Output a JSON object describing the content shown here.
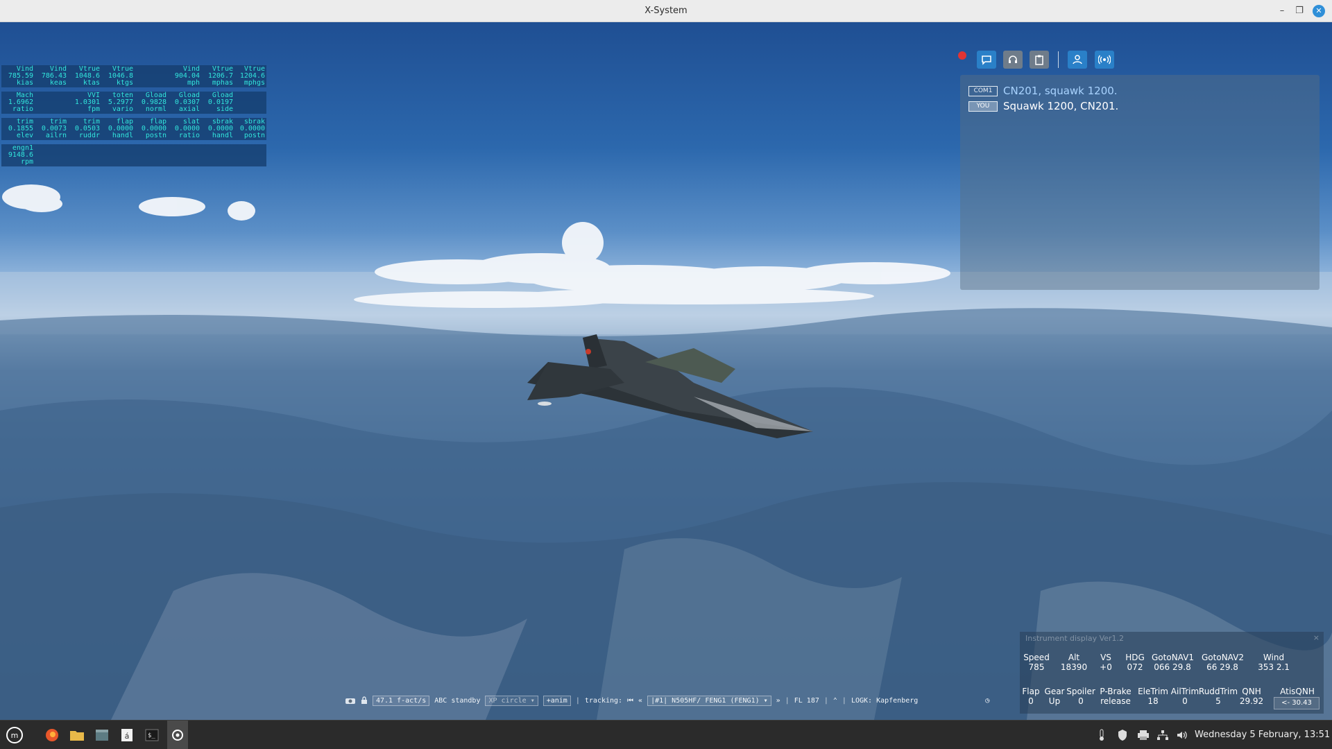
{
  "window": {
    "title": "X-System"
  },
  "data_output": {
    "rows": [
      [
        {
          "name": "Vind",
          "value": "785.59",
          "unit": "kias"
        },
        {
          "name": "Vind",
          "value": "786.43",
          "unit": "keas"
        },
        {
          "name": "Vtrue",
          "value": "1048.6",
          "unit": "ktas"
        },
        {
          "name": "Vtrue",
          "value": "1046.8",
          "unit": "ktgs"
        },
        {
          "name": "",
          "value": "",
          "unit": ""
        },
        {
          "name": "Vind",
          "value": "904.04",
          "unit": "mph"
        },
        {
          "name": "Vtrue",
          "value": "1206.7",
          "unit": "mphas"
        },
        {
          "name": "Vtrue",
          "value": "1204.6",
          "unit": "mphgs"
        }
      ],
      [
        {
          "name": "Mach",
          "value": "1.6962",
          "unit": "ratio"
        },
        {
          "name": "",
          "value": "",
          "unit": ""
        },
        {
          "name": "VVI",
          "value": "1.0301",
          "unit": "fpm"
        },
        {
          "name": "toten",
          "value": "5.2977",
          "unit": "vario"
        },
        {
          "name": "Gload",
          "value": "0.9828",
          "unit": "norml"
        },
        {
          "name": "Gload",
          "value": "0.0307",
          "unit": "axial"
        },
        {
          "name": "Gload",
          "value": "0.0197",
          "unit": "side"
        },
        {
          "name": "",
          "value": "",
          "unit": ""
        }
      ],
      [
        {
          "name": "trim",
          "value": "0.1855",
          "unit": "elev"
        },
        {
          "name": "trim",
          "value": "0.0073",
          "unit": "ailrn"
        },
        {
          "name": "trim",
          "value": "0.0503",
          "unit": "ruddr"
        },
        {
          "name": "flap",
          "value": "0.0000",
          "unit": "handl"
        },
        {
          "name": "flap",
          "value": "0.0000",
          "unit": "postn"
        },
        {
          "name": "slat",
          "value": "0.0000",
          "unit": "ratio"
        },
        {
          "name": "sbrak",
          "value": "0.0000",
          "unit": "handl"
        },
        {
          "name": "sbrak",
          "value": "0.0000",
          "unit": "postn"
        }
      ],
      [
        {
          "name": "engn1",
          "value": "9148.6",
          "unit": "rpm"
        }
      ]
    ]
  },
  "atc": {
    "messages": [
      {
        "tag": "COM1",
        "text": "CN201, squawk 1200."
      },
      {
        "tag": "YOU",
        "text": "Squawk 1200, CN201."
      }
    ]
  },
  "instrument_display": {
    "title": "Instrument display Ver1.2",
    "row1": [
      {
        "label": "Speed",
        "value": "785"
      },
      {
        "label": "Alt",
        "value": "18390"
      },
      {
        "label": "VS",
        "value": "+0"
      },
      {
        "label": "HDG",
        "value": "072"
      },
      {
        "label": "GotoNAV1",
        "value": "066   29.8"
      },
      {
        "label": "GotoNAV2",
        "value": "66   29.8"
      },
      {
        "label": "Wind",
        "value": "353   2.1"
      }
    ],
    "row2": [
      {
        "label": "Flap",
        "value": "0"
      },
      {
        "label": "Gear",
        "value": "Up"
      },
      {
        "label": "Spoiler",
        "value": "0"
      },
      {
        "label": "P-Brake",
        "value": "release"
      },
      {
        "label": "EleTrim",
        "value": "18"
      },
      {
        "label": "AilTrim",
        "value": "0"
      },
      {
        "label": "RuddTrim",
        "value": "5"
      },
      {
        "label": "QNH",
        "value": "29.92"
      },
      {
        "label": "AtisQNH",
        "value": "<- 30.43"
      }
    ]
  },
  "control_bar": {
    "speed": "47.1 f-act/s",
    "abc": "ABC standby",
    "xp": "XP circle",
    "anim": "+anim",
    "tracking_label": "tracking:",
    "target": "|#1| N505HF/ FENG1 (FENG1)",
    "fl": "FL 187",
    "logk": "LOGK: Kapfenberg"
  },
  "clock": "Wednesday 5 February, 13:51",
  "colors": {
    "accent": "#2a80c8",
    "data_text": "#32e6dc",
    "record": "#e13434"
  }
}
